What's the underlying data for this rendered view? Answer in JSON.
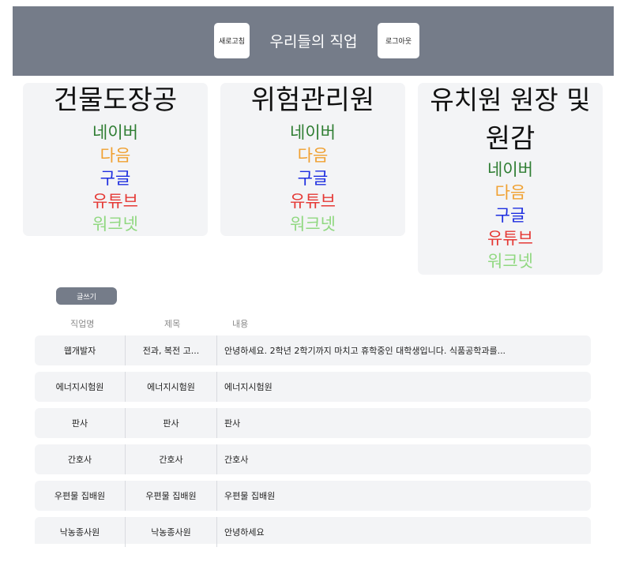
{
  "header": {
    "refresh_label": "새로고침",
    "title": "우리들의 직업",
    "logout_label": "로그아웃"
  },
  "jobs": [
    {
      "title": "건물도장공",
      "links": [
        "네이버",
        "다음",
        "구글",
        "유튜브",
        "워크넷"
      ]
    },
    {
      "title": "위험관리원",
      "links": [
        "네이버",
        "다음",
        "구글",
        "유튜브",
        "워크넷"
      ]
    },
    {
      "title_line1": "유치원 원장 및",
      "title_line2": "원감",
      "links": [
        "네이버",
        "다음",
        "구글",
        "유튜브",
        "워크넷"
      ]
    }
  ],
  "link_colors": [
    "#2e7d32",
    "#f0a030",
    "#1e2ee0",
    "#e53935",
    "#90d880"
  ],
  "write_label": "글쓰기",
  "table": {
    "headers": [
      "직업명",
      "제목",
      "내용"
    ],
    "rows": [
      [
        "웹개발자",
        "전과, 복전 고...",
        "안녕하세요. 2학년 2학기까지 마치고 휴학중인 대학생입니다. 식품공학과를..."
      ],
      [
        "에너지시험원",
        "에너지시험원",
        "에너지시험원"
      ],
      [
        "판사",
        "판사",
        "판사"
      ],
      [
        "간호사",
        "간호사",
        "간호사"
      ],
      [
        "우편물 집배원",
        "우편물 집배원",
        "우편물 집배원"
      ],
      [
        "낙농종사원",
        "낙농종사원",
        "안녕하세요"
      ]
    ]
  }
}
